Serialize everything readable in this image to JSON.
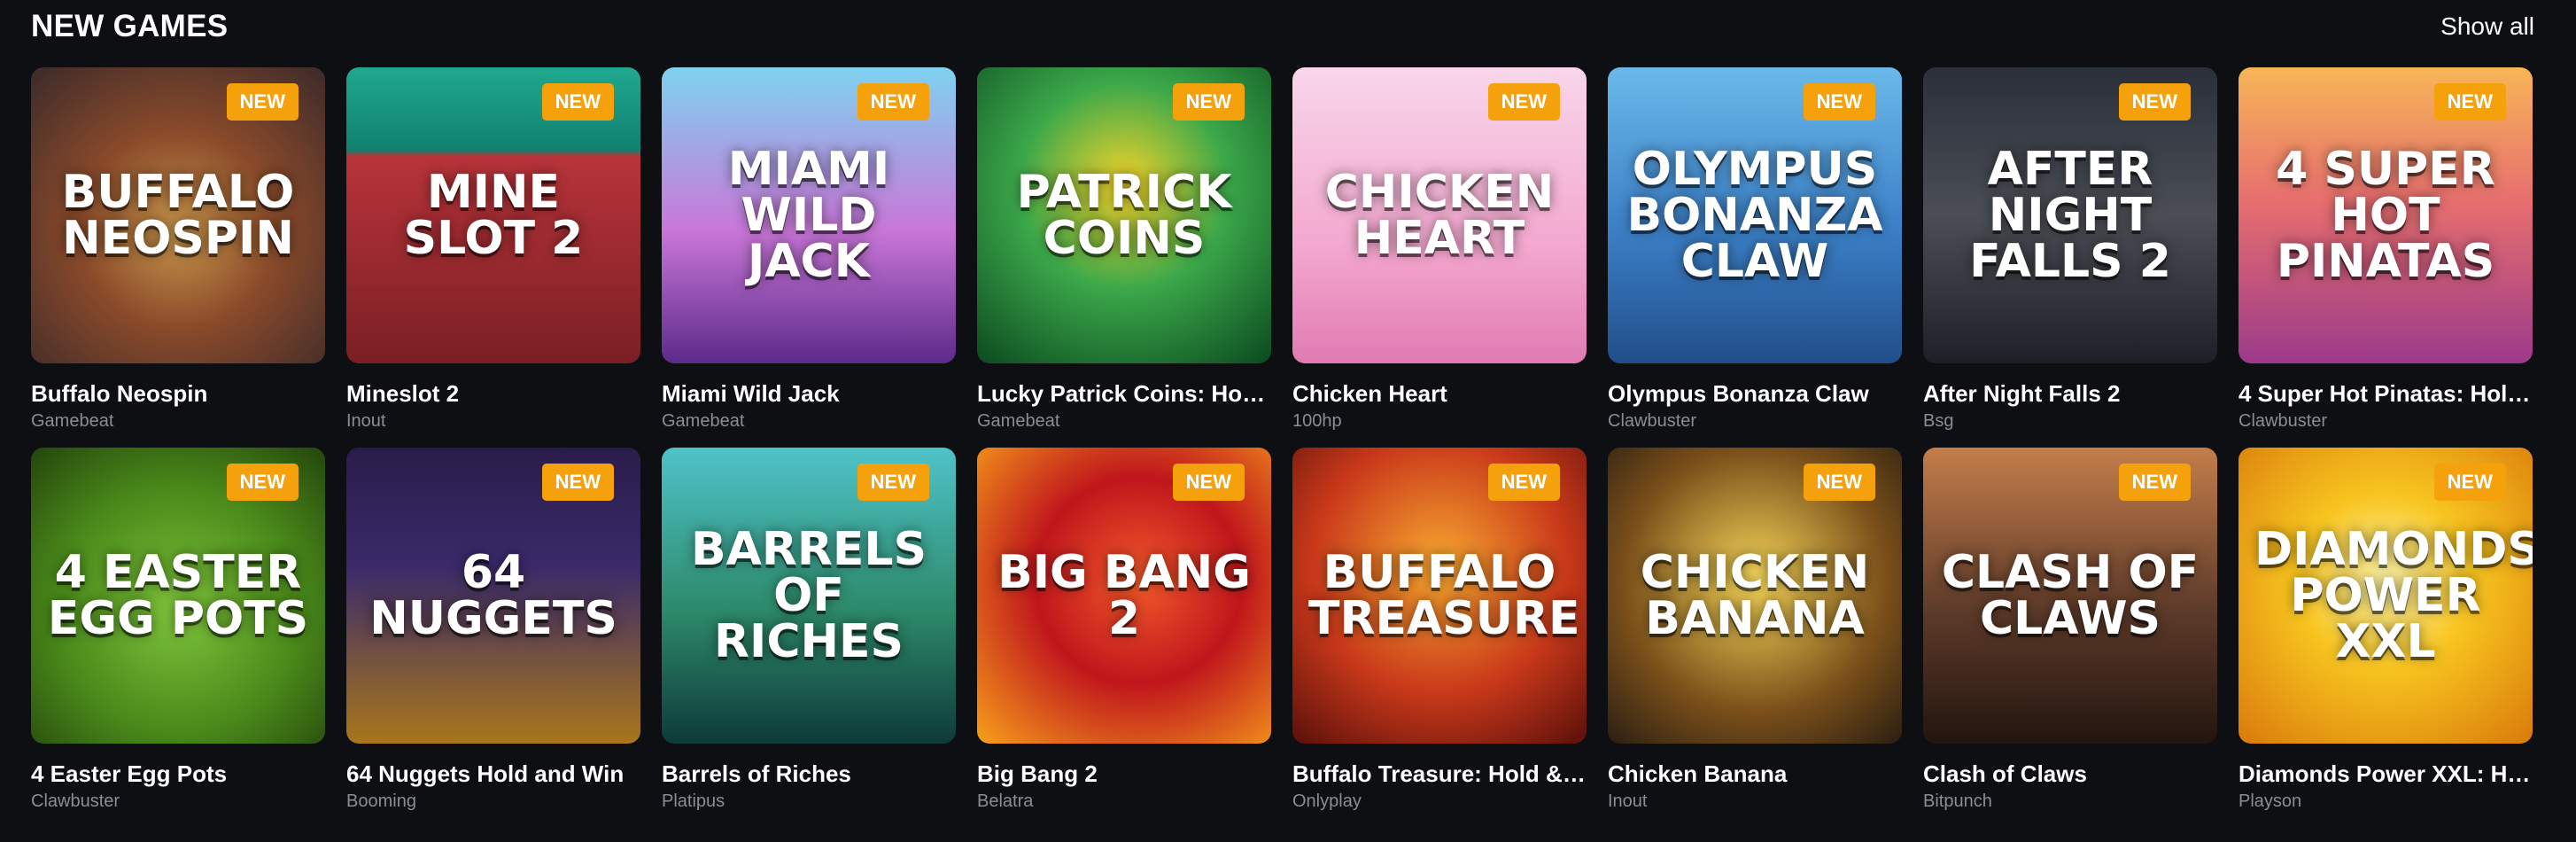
{
  "section": {
    "title": "NEW GAMES",
    "show_all": "Show all",
    "badge": "NEW"
  },
  "games": [
    {
      "name": "Buffalo Neospin",
      "provider": "Gamebeat",
      "logo": "BUFFALO neospin"
    },
    {
      "name": "Mineslot 2",
      "provider": "Inout",
      "logo": "MINE SLOT 2"
    },
    {
      "name": "Miami Wild Jack",
      "provider": "Gamebeat",
      "logo": "MIAMI Wild Jack"
    },
    {
      "name": "Lucky Patrick Coins: Hold…",
      "provider": "Gamebeat",
      "logo": "PATRICK COINS"
    },
    {
      "name": "Chicken Heart",
      "provider": "100hp",
      "logo": "CHICKEN HEART"
    },
    {
      "name": "Olympus Bonanza Claw",
      "provider": "Clawbuster",
      "logo": "OLYMPUS BONANZA CLAW"
    },
    {
      "name": "After Night Falls 2",
      "provider": "Bsg",
      "logo": "AFTER NIGHT FALLS 2"
    },
    {
      "name": "4 Super Hot Pinatas: Hol…",
      "provider": "Clawbuster",
      "logo": "4 SUPER HOT PINATAS"
    },
    {
      "name": "4 Easter Egg Pots",
      "provider": "Clawbuster",
      "logo": "4 EASTER EGG POTS"
    },
    {
      "name": "64 Nuggets Hold and Win",
      "provider": "Booming",
      "logo": "64 NUGGETS"
    },
    {
      "name": "Barrels of Riches",
      "provider": "Platipus",
      "logo": "BARRELS OF RICHES"
    },
    {
      "name": "Big Bang 2",
      "provider": "Belatra",
      "logo": "BIG BANG 2"
    },
    {
      "name": "Buffalo Treasure: Hold & …",
      "provider": "Onlyplay",
      "logo": "BUFFALO TREASURE"
    },
    {
      "name": "Chicken Banana",
      "provider": "Inout",
      "logo": "CHICKEN BANANA"
    },
    {
      "name": "Clash of Claws",
      "provider": "Bitpunch",
      "logo": "CLASH OF CLAWS"
    },
    {
      "name": "Diamonds Power XXL: Ho…",
      "provider": "Playson",
      "logo": "DIAMONDS POWER XXL"
    }
  ],
  "colors": {
    "background": "#0e0f13",
    "badge": "#f5a10c",
    "provider_text": "#8a8d96"
  }
}
